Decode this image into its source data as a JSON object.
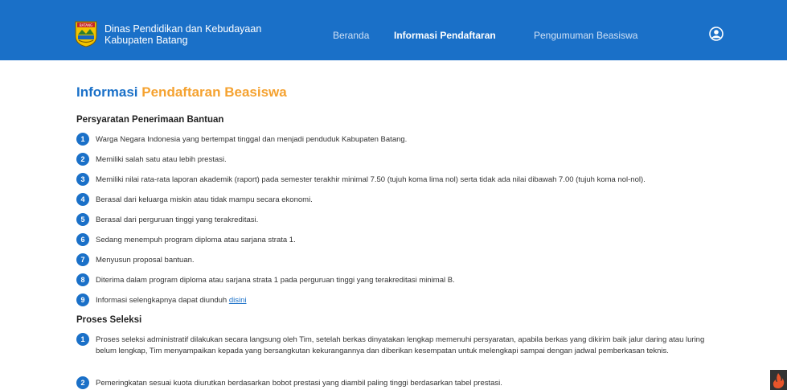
{
  "header": {
    "brand_line1": "Dinas Pendidikan dan Kebudayaan",
    "brand_line2": "Kabupaten Batang",
    "logo_label": "BATANG",
    "nav": [
      {
        "label": "Beranda",
        "active": false
      },
      {
        "label": "Informasi Pendaftaran",
        "active": true
      },
      {
        "label": "Pengumuman Beasiswa",
        "active": false
      }
    ],
    "user_icon": "user-circle-icon"
  },
  "page": {
    "title_part1": "Informasi",
    "title_part2": "Pendaftaran Beasiswa"
  },
  "requirements": {
    "title": "Persyaratan Penerimaan Bantuan",
    "items": [
      {
        "num": "1",
        "text": "Warga Negara Indonesia yang bertempat tinggal dan menjadi penduduk Kabupaten Batang."
      },
      {
        "num": "2",
        "text": "Memiliki salah satu atau lebih prestasi."
      },
      {
        "num": "3",
        "text": "Memiliki nilai rata-rata laporan akademik (raport) pada semester terakhir minimal 7.50 (tujuh koma lima nol) serta tidak ada nilai dibawah 7.00 (tujuh koma nol-nol)."
      },
      {
        "num": "4",
        "text": "Berasal dari keluarga miskin atau tidak mampu secara ekonomi."
      },
      {
        "num": "5",
        "text": "Berasal dari perguruan tinggi yang terakreditasi."
      },
      {
        "num": "6",
        "text": "Sedang menempuh program diploma atau sarjana strata 1."
      },
      {
        "num": "7",
        "text": "Menyusun proposal bantuan."
      },
      {
        "num": "8",
        "text": "Diterima dalam program diploma atau sarjana strata 1 pada perguruan tinggi yang terakreditasi minimal B."
      },
      {
        "num": "9",
        "text": "Informasi selengkapnya dapat diunduh ",
        "link": "disini"
      }
    ]
  },
  "selection": {
    "title": "Proses Seleksi",
    "items": [
      {
        "num": "1",
        "text": "Proses seleksi administratif dilakukan secara langsung oleh Tim, setelah berkas dinyatakan lengkap memenuhi persyaratan, apabila berkas yang dikirim baik jalur daring atau luring belum lengkap, Tim menyampaikan kepada yang bersangkutan kekurangannya dan diberikan kesempatan untuk melengkapi sampai dengan jadwal pemberkasan teknis."
      },
      {
        "num": "2",
        "text": "Pemeringkatan sesuai kuota diurutkan berdasarkan bobot prestasi yang diambil paling tinggi berdasarkan tabel prestasi."
      }
    ]
  },
  "colors": {
    "primary": "#1a70c8",
    "accent": "#f5a230"
  }
}
